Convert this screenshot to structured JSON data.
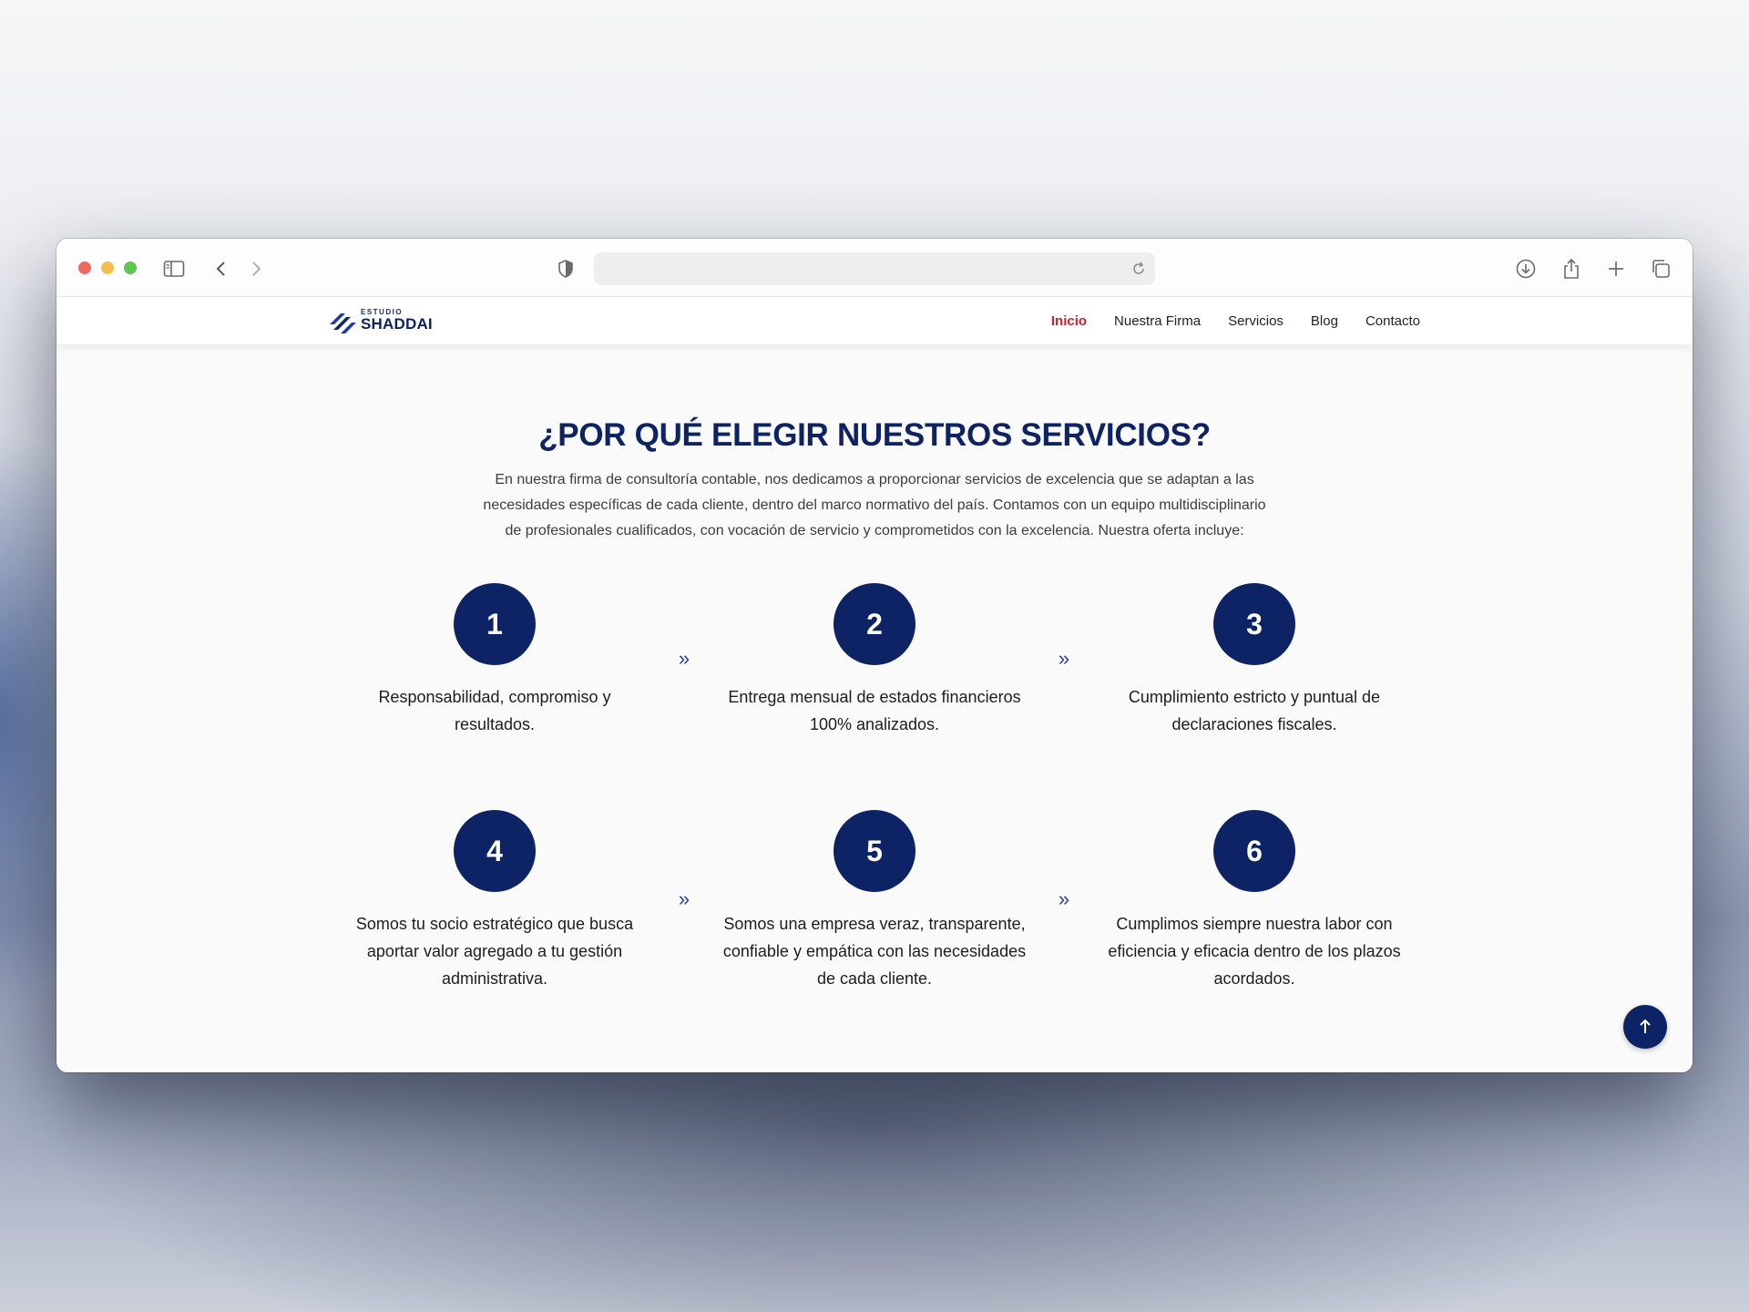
{
  "site": {
    "logo_small": "ESTUDIO",
    "logo_big": "SHADDAI",
    "nav": [
      {
        "label": "Inicio",
        "active": true
      },
      {
        "label": "Nuestra Firma",
        "active": false
      },
      {
        "label": "Servicios",
        "active": false
      },
      {
        "label": "Blog",
        "active": false
      },
      {
        "label": "Contacto",
        "active": false
      }
    ]
  },
  "section": {
    "title": "¿POR QUÉ ELEGIR NUESTROS SERVICIOS?",
    "intro_lines": [
      "En nuestra firma de consultoría contable, nos dedicamos a proporcionar servicios de excelencia que se adaptan a las",
      "necesidades específicas de cada cliente, dentro del marco normativo del país. Contamos con un equipo multidisciplinario",
      "de profesionales cualificados, con vocación de servicio y comprometidos con la excelencia. Nuestra oferta incluye:"
    ],
    "items": [
      {
        "number": "1",
        "lines": [
          "Responsabilidad, compromiso y",
          "resultados."
        ]
      },
      {
        "number": "2",
        "lines": [
          "Entrega mensual de estados financieros",
          "100% analizados."
        ]
      },
      {
        "number": "3",
        "lines": [
          "Cumplimiento estricto y puntual de",
          "declaraciones fiscales."
        ]
      },
      {
        "number": "4",
        "lines": [
          "Somos tu socio estratégico que busca",
          "aportar valor agregado a tu gestión",
          "administrativa."
        ]
      },
      {
        "number": "5",
        "lines": [
          "Somos una empresa veraz, transparente,",
          "confiable y empática con las necesidades",
          "de cada cliente."
        ]
      },
      {
        "number": "6",
        "lines": [
          "Cumplimos siempre nuestra labor con",
          "eficiencia y eficacia dentro de los plazos",
          "acordados."
        ]
      }
    ],
    "arrow_glyph": "»"
  },
  "colors": {
    "brand_navy": "#0d2366",
    "active_nav": "#c0282f",
    "traffic_red": "#ed6a5e",
    "traffic_yellow": "#f5bf4f",
    "traffic_green": "#61c554"
  },
  "icons": {
    "browser": [
      "sidebar-icon",
      "back-icon",
      "forward-icon",
      "shield-icon",
      "reload-icon",
      "download-icon",
      "share-icon",
      "new-tab-icon",
      "tabs-icon"
    ],
    "scroll_top": "arrow-up-icon"
  }
}
